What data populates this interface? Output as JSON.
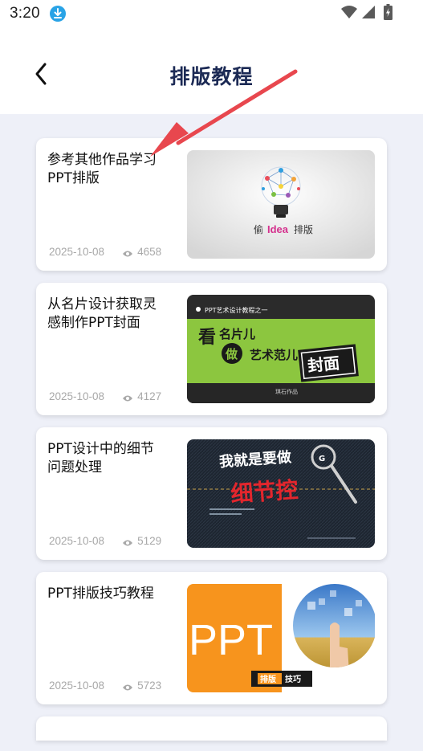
{
  "status_bar": {
    "time": "3:20"
  },
  "header": {
    "title": "排版教程"
  },
  "articles": [
    {
      "title": "参考其他作品学习PPT排版",
      "date": "2025-10-08",
      "views": "4658",
      "thumb_text": "偷",
      "thumb_text_idea": "Idea",
      "thumb_text_end": "排版"
    },
    {
      "title": "从名片设计获取灵感制作PPT封面",
      "date": "2025-10-08",
      "views": "4127",
      "thumb_header": "PPT艺术设计教程之一",
      "thumb_line1": "看",
      "thumb_line1b": "名片儿",
      "thumb_circle": "做",
      "thumb_line2": "艺术范儿",
      "thumb_box": "封面",
      "thumb_caption": "琪石作品"
    },
    {
      "title": "PPT设计中的细节问题处理",
      "date": "2025-10-08",
      "views": "5129",
      "thumb_top": "我就是要做",
      "thumb_red": "细节控",
      "thumb_logo": "G"
    },
    {
      "title": "PPT排版技巧教程",
      "date": "2025-10-08",
      "views": "5723",
      "thumb_big": "PPT",
      "thumb_tag1": "排版",
      "thumb_tag2": "技巧"
    }
  ],
  "colors": {
    "title": "#1c2a55",
    "accent_arrow": "#e8474e",
    "content_bg": "#eef0f8",
    "meta_text": "#a8a8a8",
    "status_download": "#29a3e6"
  }
}
